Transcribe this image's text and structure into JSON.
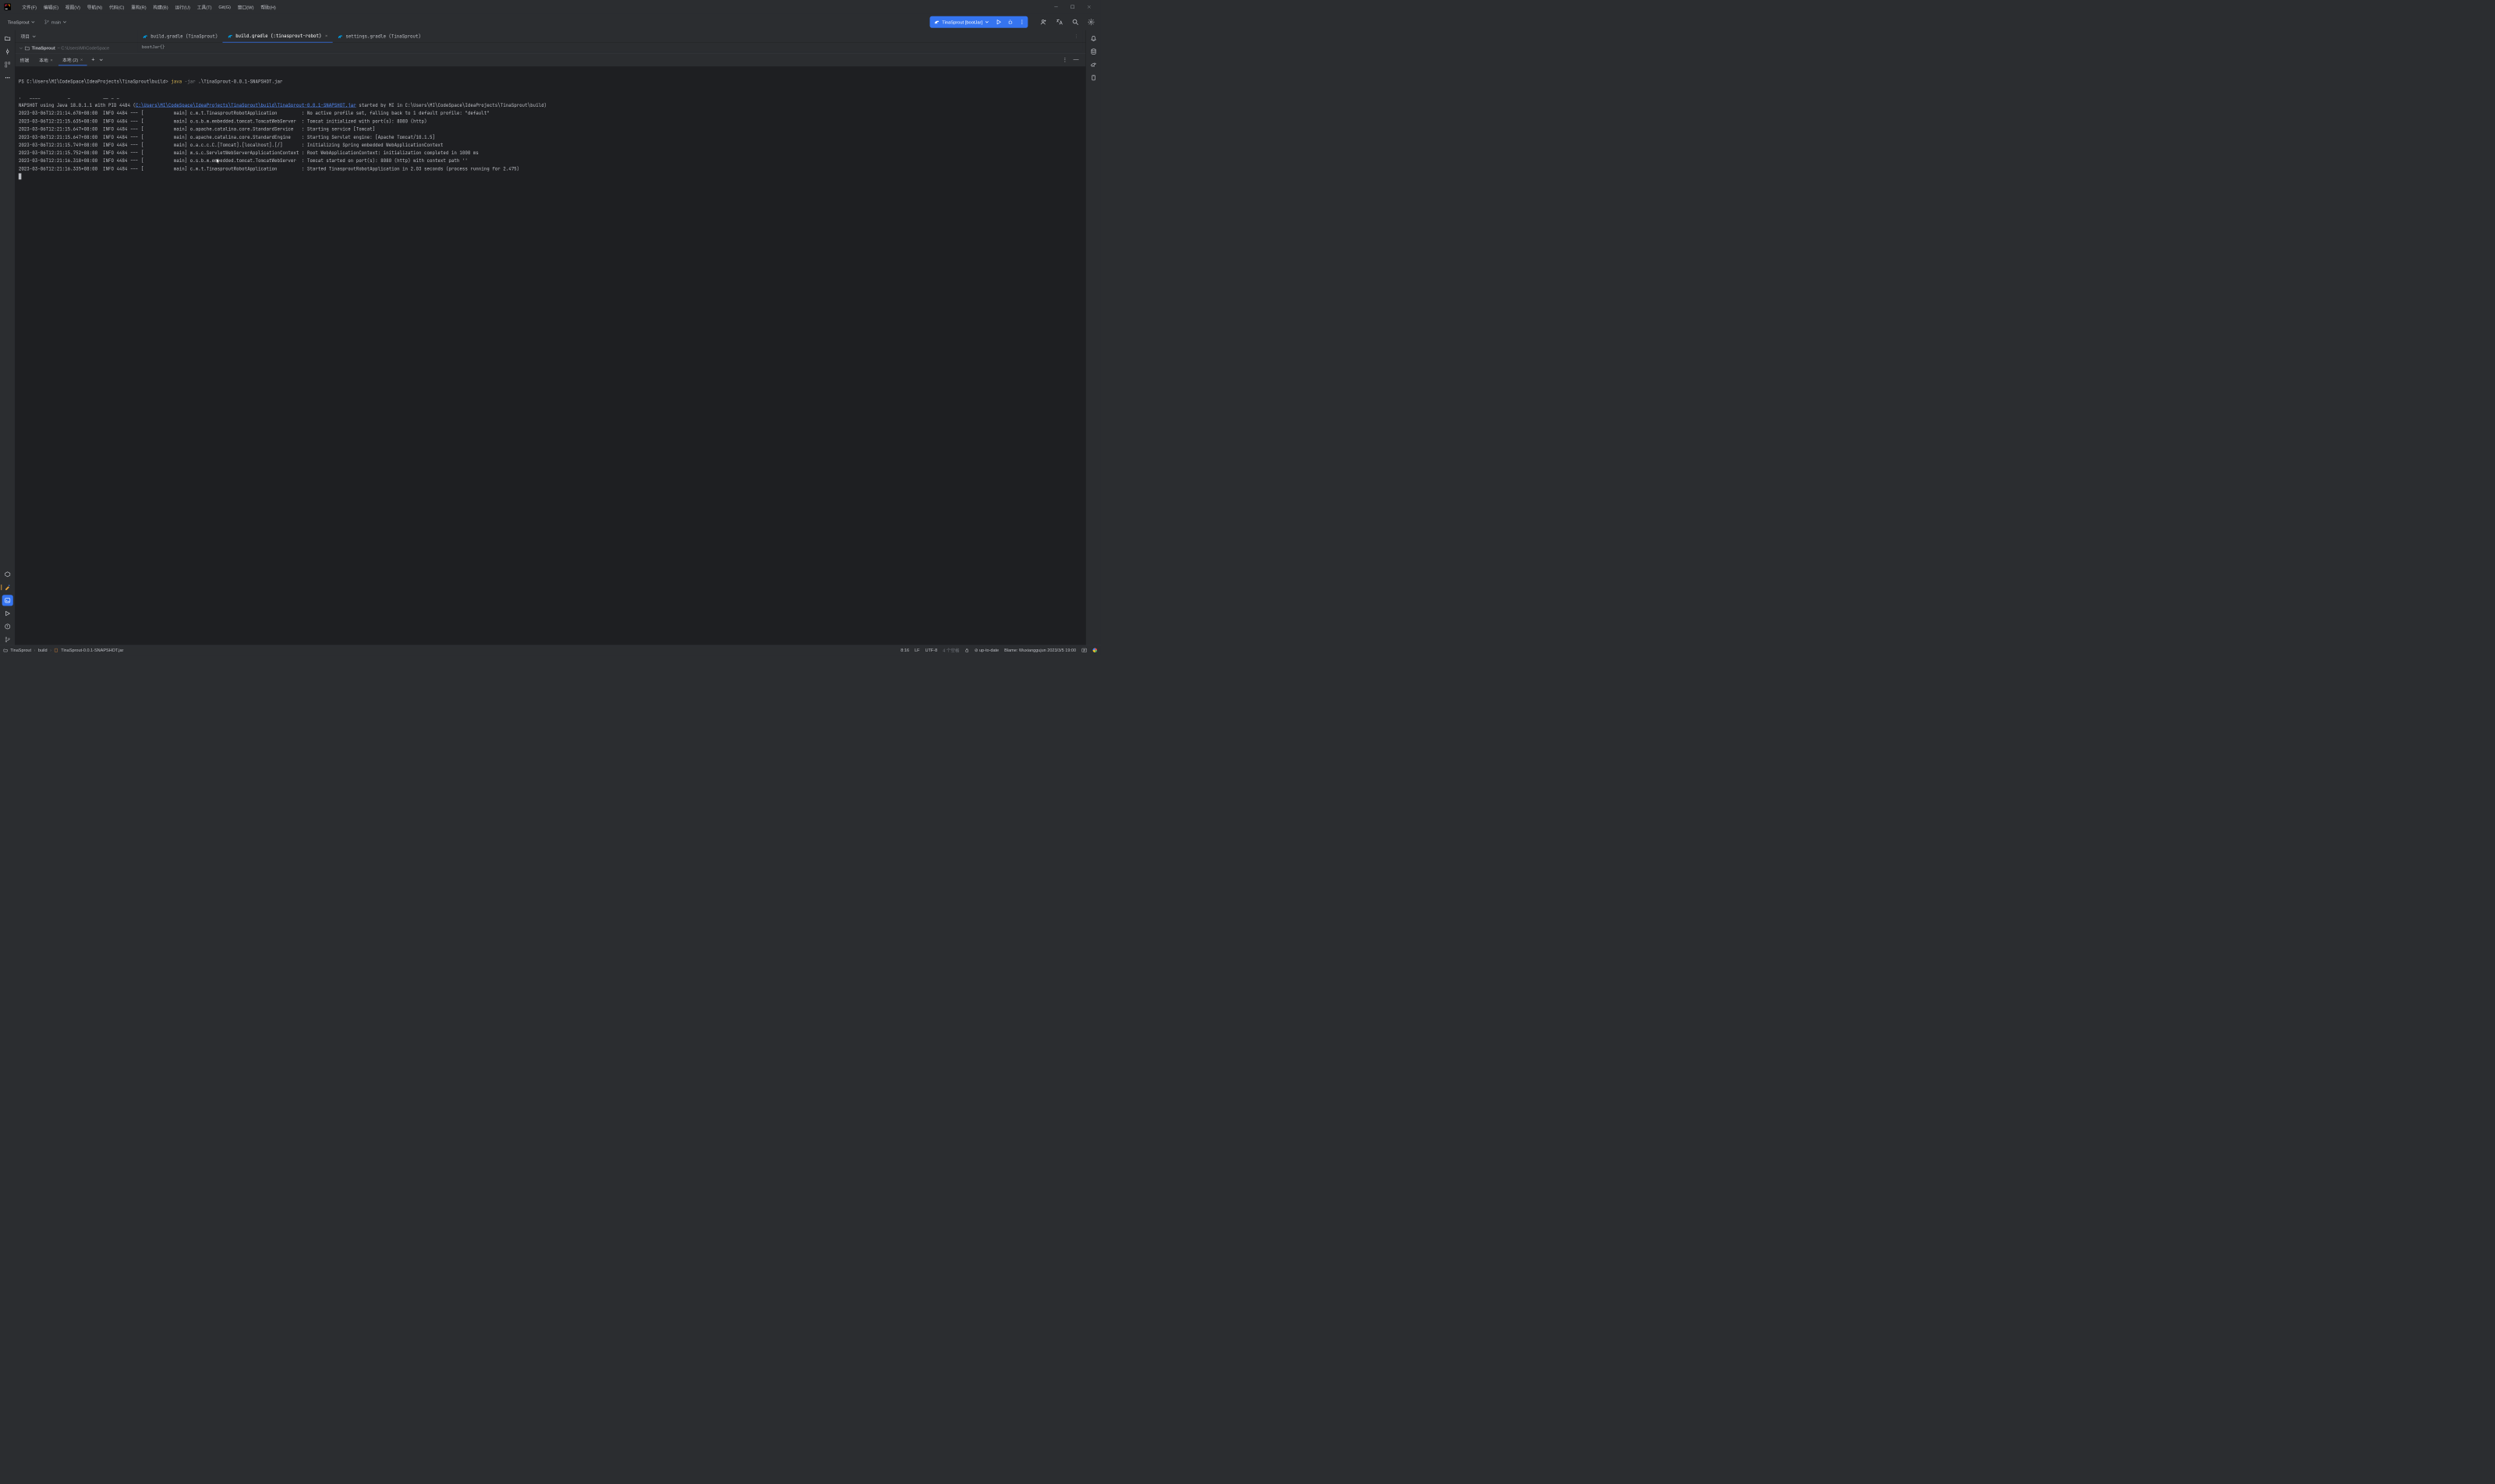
{
  "menus": [
    "文件(F)",
    "编辑(E)",
    "视图(V)",
    "导航(N)",
    "代码(C)",
    "重构(R)",
    "构建(B)",
    "运行(U)",
    "工具(T)",
    "Git(G)",
    "窗口(W)",
    "帮助(H)"
  ],
  "project_name": "TinaSprout",
  "branch": "main",
  "run_config": "TinaSprout [bootJar]",
  "project_tool": {
    "label": "项目"
  },
  "project_tree": {
    "root": "TinaSprout",
    "root_path": "~  C:\\Users\\MI\\CodeSpace"
  },
  "editor_tabs": [
    {
      "label": "build.gradle (TinaSprout)",
      "active": false,
      "closable": false
    },
    {
      "label": "build.gradle (:tinasprout-robot)",
      "active": true,
      "closable": true
    },
    {
      "label": "settings.gradle (TinaSprout)",
      "active": false,
      "closable": false
    }
  ],
  "editor_breadcrumb": "bootJar{}",
  "terminal": {
    "title": "终端",
    "tabs": [
      {
        "label": "本地",
        "active": false,
        "closable": true
      },
      {
        "label": "本地 (2)",
        "active": true,
        "closable": true
      }
    ],
    "prompt_prefix": "PS C:\\Users\\MI\\CodeSpace\\IdeaProjects\\TinaSprout\\build> ",
    "cmd_java": "java",
    "cmd_jar": " -jar ",
    "cmd_file": ".\\TinaSprout-0.0.1-SNAPSHOT.jar",
    "log_prelink": "NAPSHOT using Java 18.0.1.1 with PID 4484 (",
    "log_link": "C:\\Users\\MI\\CodeSpace\\IdeaProjects\\TinaSprout\\build\\TinaSprout-0.0.1-SNAPSHOT.jar",
    "log_postlink": " started by MI in C:\\Users\\MI\\CodeSpace\\IdeaProjects\\TinaSprout\\build)",
    "artifact_line_pre": ".   ____          _            __ _ _",
    "lines": [
      "2023-03-06T12:21:14.678+08:00  INFO 4484 --- [           main] c.w.t.TinasproutRobotApplication         : No active profile set, falling back to 1 default profile: \"default\"",
      "2023-03-06T12:21:15.635+08:00  INFO 4484 --- [           main] o.s.b.w.embedded.tomcat.TomcatWebServer  : Tomcat initialized with port(s): 8080 (http)",
      "2023-03-06T12:21:15.647+08:00  INFO 4484 --- [           main] o.apache.catalina.core.StandardService   : Starting service [Tomcat]",
      "2023-03-06T12:21:15.647+08:00  INFO 4484 --- [           main] o.apache.catalina.core.StandardEngine    : Starting Servlet engine: [Apache Tomcat/10.1.5]",
      "2023-03-06T12:21:15.749+08:00  INFO 4484 --- [           main] o.a.c.c.C.[Tomcat].[localhost].[/]       : Initializing Spring embedded WebApplicationContext",
      "2023-03-06T12:21:15.752+08:00  INFO 4484 --- [           main] w.s.c.ServletWebServerApplicationContext : Root WebApplicationContext: initialization completed in 1000 ms",
      "2023-03-06T12:21:16.318+08:00  INFO 4484 --- [           main] o.s.b.w.embedded.tomcat.TomcatWebServer  : Tomcat started on port(s): 8080 (http) with context path ''",
      "2023-03-06T12:21:16.335+08:00  INFO 4484 --- [           main] c.w.t.TinasproutRobotApplication         : Started TinasproutRobotApplication in 2.03 seconds (process running for 2.475)"
    ]
  },
  "status": {
    "crumbs": [
      "TinaSprout",
      "build",
      "TinaSprout-0.0.1-SNAPSHOT.jar"
    ],
    "pos": "8:16",
    "eol": "LF",
    "enc": "UTF-8",
    "indent": "4 个空格",
    "sync": "up-to-date",
    "blame": "Blame: Wuxianggujun 2023/3/5 19:00"
  }
}
